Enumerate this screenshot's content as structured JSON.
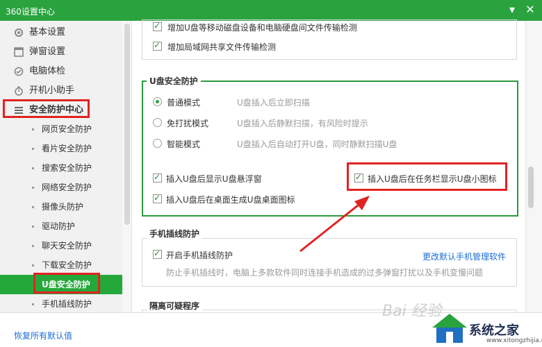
{
  "window": {
    "title": "360设置中心",
    "minimize": "▾",
    "close": "✕"
  },
  "sidebar": {
    "items": [
      {
        "label": "基本设置",
        "icon": "gear-icon"
      },
      {
        "label": "弹窗设置",
        "icon": "window-icon"
      },
      {
        "label": "电脑体检",
        "icon": "checkup-icon"
      },
      {
        "label": "开机小助手",
        "icon": "timer-icon"
      },
      {
        "label": "安全防护中心",
        "icon": "list-icon"
      }
    ],
    "subitems": [
      "网页安全防护",
      "看片安全防护",
      "搜索安全防护",
      "网络安全防护",
      "摄像头防护",
      "驱动防护",
      "聊天安全防护",
      "下载安全防护",
      "U盘安全防护",
      "手机插线防护"
    ],
    "active_subitem": "U盘安全防护"
  },
  "main": {
    "top_options": [
      "增加U盘等移动磁盘设备和电脑硬盘间文件传输检测",
      "增加局域网共享文件传输检测"
    ],
    "usb": {
      "title": "U盘安全防护",
      "modes": [
        {
          "label": "普通模式",
          "desc": "U盘插入后立即扫描",
          "checked": true
        },
        {
          "label": "免打扰模式",
          "desc": "U盘插入后静默扫描，有风险时提示",
          "checked": false
        },
        {
          "label": "智能模式",
          "desc": "U盘插入后自动打开U盘，同时静默扫描U盘",
          "checked": false
        }
      ],
      "options": [
        "插入U盘后显示U盘悬浮窗",
        "插入U盘后在任务栏显示U盘小图标",
        "插入U盘后在桌面生成U盘桌面图标"
      ]
    },
    "phone": {
      "title": "手机插线防护",
      "option": "开启手机插线防护",
      "link": "更改默认手机管理软件",
      "desc": "防止手机插线时，电脑上多款软件同时连接手机造成的过多弹窗打扰以及手机变慢问题"
    },
    "isolation": {
      "title": "隔离可疑程序"
    }
  },
  "bottom": {
    "restore": "恢复所有默认值"
  },
  "watermark": {
    "brand": "系统之家",
    "url": "www.xitongzhijia.net",
    "faint": "Bai 经验"
  },
  "colors": {
    "accent": "#2aa33f",
    "annotation": "#e22222",
    "link": "#1a6ed8"
  }
}
